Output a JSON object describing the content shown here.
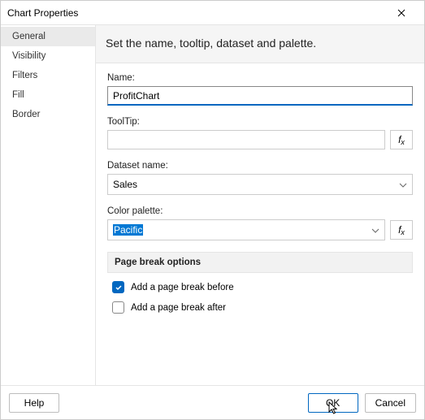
{
  "dialog": {
    "title": "Chart Properties"
  },
  "sidebar": {
    "items": [
      {
        "label": "General",
        "selected": true
      },
      {
        "label": "Visibility",
        "selected": false
      },
      {
        "label": "Filters",
        "selected": false
      },
      {
        "label": "Fill",
        "selected": false
      },
      {
        "label": "Border",
        "selected": false
      }
    ]
  },
  "main": {
    "instruction": "Set the name, tooltip, dataset and palette.",
    "name": {
      "label": "Name:",
      "value": "ProfitChart"
    },
    "tooltip": {
      "label": "ToolTip:",
      "value": ""
    },
    "dataset": {
      "label": "Dataset name:",
      "value": "Sales"
    },
    "palette": {
      "label": "Color palette:",
      "value": "Pacific"
    },
    "page_break": {
      "header": "Page break options",
      "before": {
        "label": "Add a page break before",
        "checked": true
      },
      "after": {
        "label": "Add a page break after",
        "checked": false
      }
    }
  },
  "footer": {
    "help": "Help",
    "ok": "OK",
    "cancel": "Cancel"
  }
}
